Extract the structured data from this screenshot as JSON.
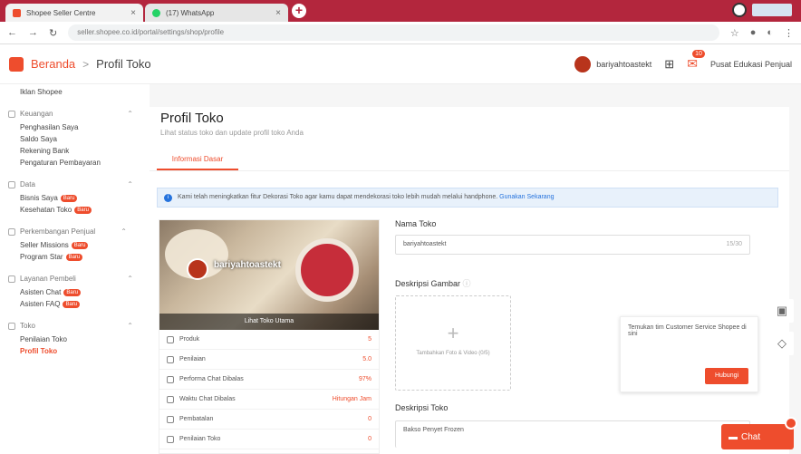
{
  "browser": {
    "tabs": [
      {
        "title": "Shopee Seller Centre",
        "color": "#ee4d2d"
      },
      {
        "title": "(17) WhatsApp",
        "color": "#25d366"
      }
    ],
    "url": "seller.shopee.co.id/portal/settings/shop/profile",
    "brand_color": "#b3263d"
  },
  "header": {
    "home": "Beranda",
    "separator": ">",
    "current": "Profil Toko",
    "username": "bariyahtoastekt",
    "chat_badge": "10",
    "right_link": "Pusat Edukasi Penjual"
  },
  "sidebar": {
    "top_item": "Iklan Shopee",
    "sections": [
      {
        "title": "Keuangan",
        "items": [
          {
            "label": "Penghasilan Saya",
            "new": false,
            "active": false
          },
          {
            "label": "Saldo Saya",
            "new": false,
            "active": false
          },
          {
            "label": "Rekening Bank",
            "new": false,
            "active": false
          },
          {
            "label": "Pengaturan Pembayaran",
            "new": false,
            "active": false
          }
        ]
      },
      {
        "title": "Data",
        "items": [
          {
            "label": "Bisnis Saya",
            "new": true,
            "active": false
          },
          {
            "label": "Kesehatan Toko",
            "new": true,
            "active": false
          }
        ]
      },
      {
        "title": "Perkembangan Penjual",
        "items": [
          {
            "label": "Seller Missions",
            "new": true,
            "active": false
          },
          {
            "label": "Program Star",
            "new": true,
            "active": false
          }
        ]
      },
      {
        "title": "Layanan Pembeli",
        "items": [
          {
            "label": "Asisten Chat",
            "new": true,
            "active": false
          },
          {
            "label": "Asisten FAQ",
            "new": true,
            "active": false
          }
        ]
      },
      {
        "title": "Toko",
        "items": [
          {
            "label": "Penilaian Toko",
            "new": false,
            "active": false
          },
          {
            "label": "Profil Toko",
            "new": false,
            "active": true
          }
        ]
      }
    ],
    "new_label": "Baru"
  },
  "main": {
    "title": "Profil Toko",
    "subtitle": "Lihat status toko dan update profil toko Anda",
    "tab": "Informasi Dasar",
    "notice": "Kami telah meningkatkan fitur Dekorasi Toko agar kamu dapat mendekorasi toko lebih mudah melalui handphone.",
    "notice_link": "Gunakan Sekarang",
    "preview": {
      "shop_name": "bariyahtoastekt",
      "overlay": "Lihat Toko Utama",
      "stats": [
        {
          "label": "Produk",
          "value": "5"
        },
        {
          "label": "Penilaian",
          "value": "5.0"
        },
        {
          "label": "Performa Chat Dibalas",
          "value": "97%"
        },
        {
          "label": "Waktu Chat Dibalas",
          "value": "Hitungan Jam"
        },
        {
          "label": "Pembatalan",
          "value": "0"
        },
        {
          "label": "Penilaian Toko",
          "value": "0"
        }
      ]
    },
    "form": {
      "name_label": "Nama Toko",
      "name_value": "bariyahtoastekt",
      "name_count": "15/30",
      "image_label": "Deskripsi Gambar",
      "upload_text": "Tambahkan Foto & Video (0/5)",
      "desc_label": "Deskripsi Toko",
      "desc_value": "Bakso Penyet Frozen"
    },
    "cs_card": {
      "text": "Temukan tim Customer Service Shopee di sini",
      "button": "Hubungi"
    }
  },
  "chat_button": "Chat",
  "accent_color": "#ee4d2d"
}
